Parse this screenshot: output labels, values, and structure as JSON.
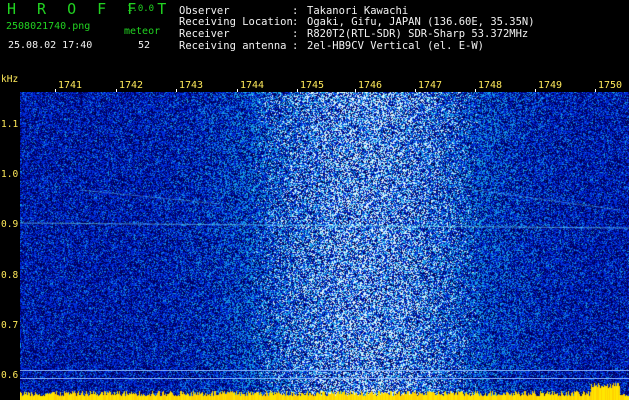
{
  "app": {
    "name": "H R O F F T",
    "version": "1.0.0"
  },
  "file": {
    "name": "2508021740.png",
    "timestamp": "25.08.02 17:40"
  },
  "meteor": {
    "label": "meteor",
    "count": "52"
  },
  "info": [
    {
      "key": "Observer",
      "sep": ":",
      "value": "Takanori Kawachi"
    },
    {
      "key": "Receiving Location",
      "sep": ":",
      "value": "Ogaki, Gifu, JAPAN (136.60E, 35.35N)"
    },
    {
      "key": "Receiver",
      "sep": ":",
      "value": "R820T2(RTL-SDR) SDR-Sharp 53.372MHz"
    },
    {
      "key": "Receiving antenna",
      "sep": ":",
      "value": "2el-HB9CV Vertical (el. E-W)"
    }
  ],
  "axis": {
    "y_unit": "kHz",
    "x_ticks": [
      "1741",
      "1742",
      "1743",
      "1744",
      "1745",
      "1746",
      "1747",
      "1748",
      "1749",
      "1750"
    ],
    "y_ticks": [
      "1.1",
      "1.0",
      "0.9",
      "0.8",
      "0.7",
      "0.6"
    ]
  },
  "colors": {
    "background": "#000000",
    "header_green": "#21d321",
    "header_white": "#f2f2f2",
    "tick_yellow": "#ffea5a",
    "signal_line": "#7ff0ff"
  }
}
